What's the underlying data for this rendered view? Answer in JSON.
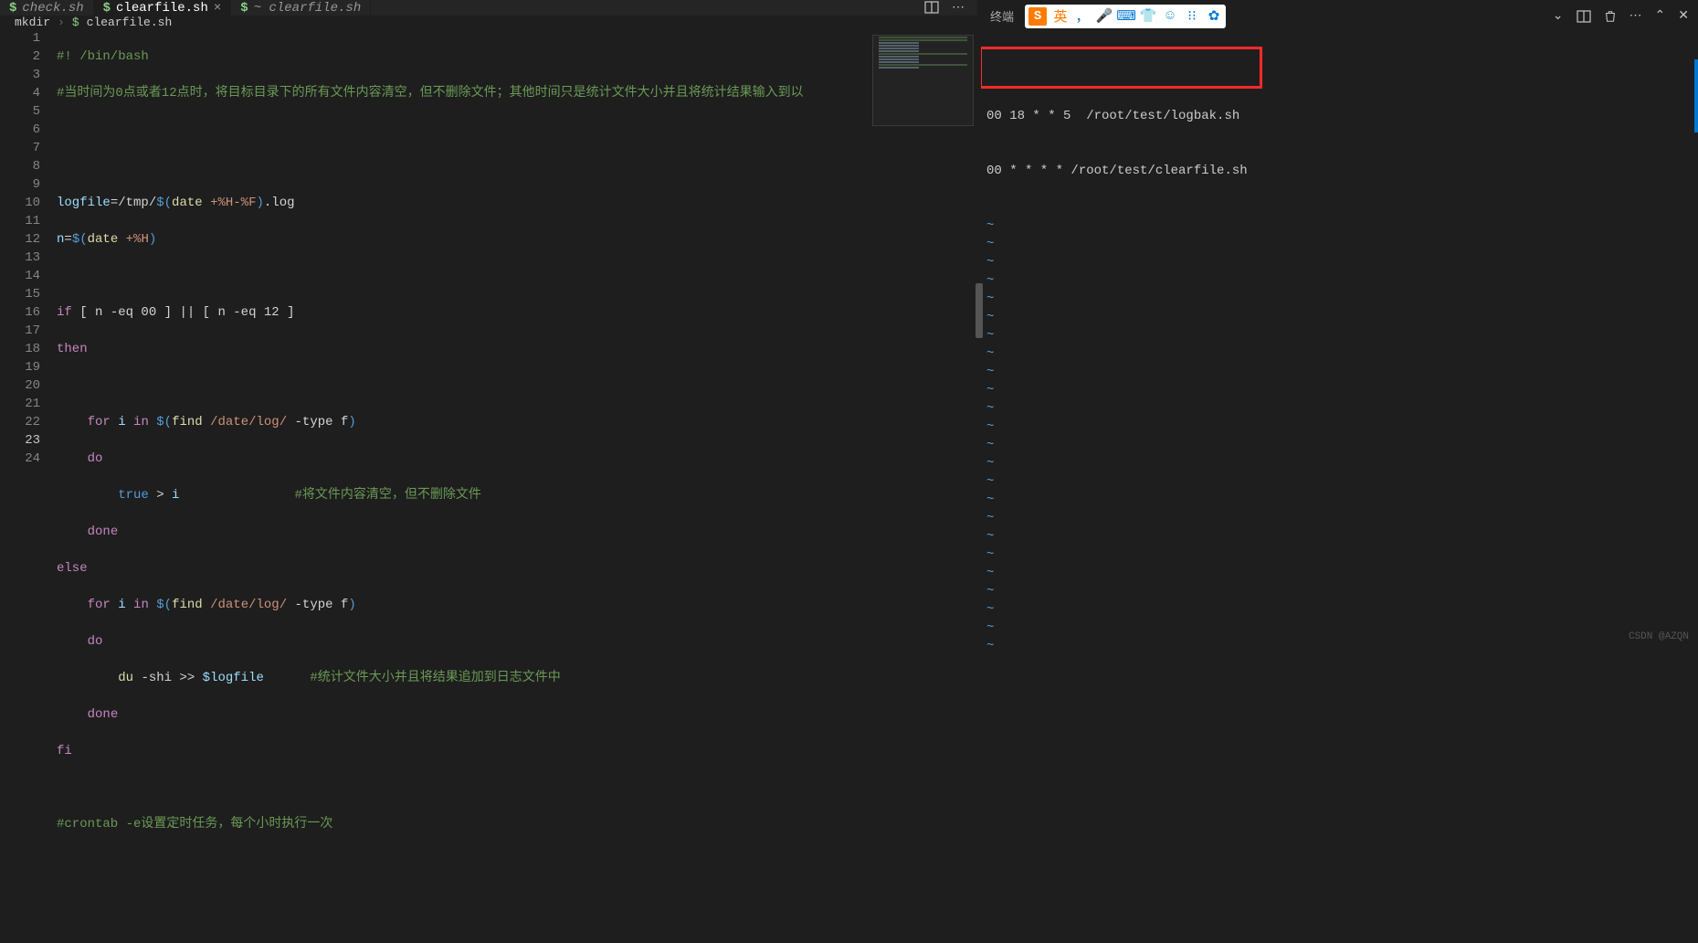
{
  "tabs": [
    {
      "label": "check.sh",
      "active": false,
      "modified": false
    },
    {
      "label": "clearfile.sh",
      "active": true,
      "modified": false
    },
    {
      "label": "~ clearfile.sh",
      "active": false,
      "modified": false,
      "italic": true
    }
  ],
  "tab_actions": {
    "close": "×",
    "split": "⊞",
    "more": "⋯"
  },
  "breadcrumb": {
    "folder": "mkdir",
    "file": "clearfile.sh",
    "sep": "›"
  },
  "line_numbers": [
    "1",
    "2",
    "3",
    "4",
    "5",
    "6",
    "7",
    "8",
    "9",
    "10",
    "11",
    "12",
    "13",
    "14",
    "15",
    "16",
    "17",
    "18",
    "19",
    "20",
    "21",
    "22",
    "23",
    "24"
  ],
  "current_line": 23,
  "code": {
    "l1_shebang": "#! /bin/bash",
    "l2_comment": "#当时间为0点或者12点时，将目标目录下的所有文件内容清空，但不删除文件；其他时间只是统计文件大小并且将统计结果输入到以",
    "l5_var": "logfile",
    "l5_eq": "=",
    "l5_path": "/tmp/",
    "l5_subst_open": "$(",
    "l5_cmd": "date",
    "l5_arg": "+%H-%F",
    "l5_subst_close": ")",
    "l5_ext": ".log",
    "l6_var": "n",
    "l6_eq": "=",
    "l6_subst": "$(",
    "l6_cmd": "date",
    "l6_arg": "+%H",
    "l6_close": ")",
    "l8_if": "if",
    "l8_test1": "[ n -eq 00 ]",
    "l8_or": "||",
    "l8_test2": "[ n -eq 12 ]",
    "l9_then": "then",
    "l11_for": "for",
    "l11_i": "i",
    "l11_in": "in",
    "l11_subst": "$(",
    "l11_find": "find",
    "l11_path": "/date/log/",
    "l11_type": "-type f",
    "l11_close": ")",
    "l12_do": "do",
    "l13_true": "true",
    "l13_gt": ">",
    "l13_i": "i",
    "l13_comment": "#将文件内容清空，但不删除文件",
    "l14_done": "done",
    "l15_else": "else",
    "l16_for": "for",
    "l16_i": "i",
    "l16_in": "in",
    "l16_subst": "$(",
    "l16_find": "find",
    "l16_path": "/date/log/",
    "l16_type": "-type f",
    "l16_close": ")",
    "l17_do": "do",
    "l18_du": "du",
    "l18_opt": "-shi",
    "l18_append": ">>",
    "l18_var": "$logfile",
    "l18_comment": "#统计文件大小并且将结果追加到日志文件中",
    "l19_done": "done",
    "l20_fi": "fi",
    "l22_comment": "#crontab -e设置定时任务，每个小时执行一次"
  },
  "terminal": {
    "label": "终端",
    "ime": {
      "logo": "S",
      "lang": "英",
      "icons": [
        "，",
        "🎤",
        "⌨",
        "👕",
        "☺",
        "⁝⁝",
        "✿"
      ]
    },
    "toolbar": {
      "chevron": "⌄",
      "split": "□",
      "trash": "🗑",
      "more": "⋯",
      "up": "⌃",
      "close": "✕"
    },
    "lines": [
      "00 18 * * 5  /root/test/logbak.sh",
      "00 * * * * /root/test/clearfile.sh"
    ],
    "tilde": "~",
    "tilde_count": 25
  },
  "watermark": "CSDN @AZQN"
}
